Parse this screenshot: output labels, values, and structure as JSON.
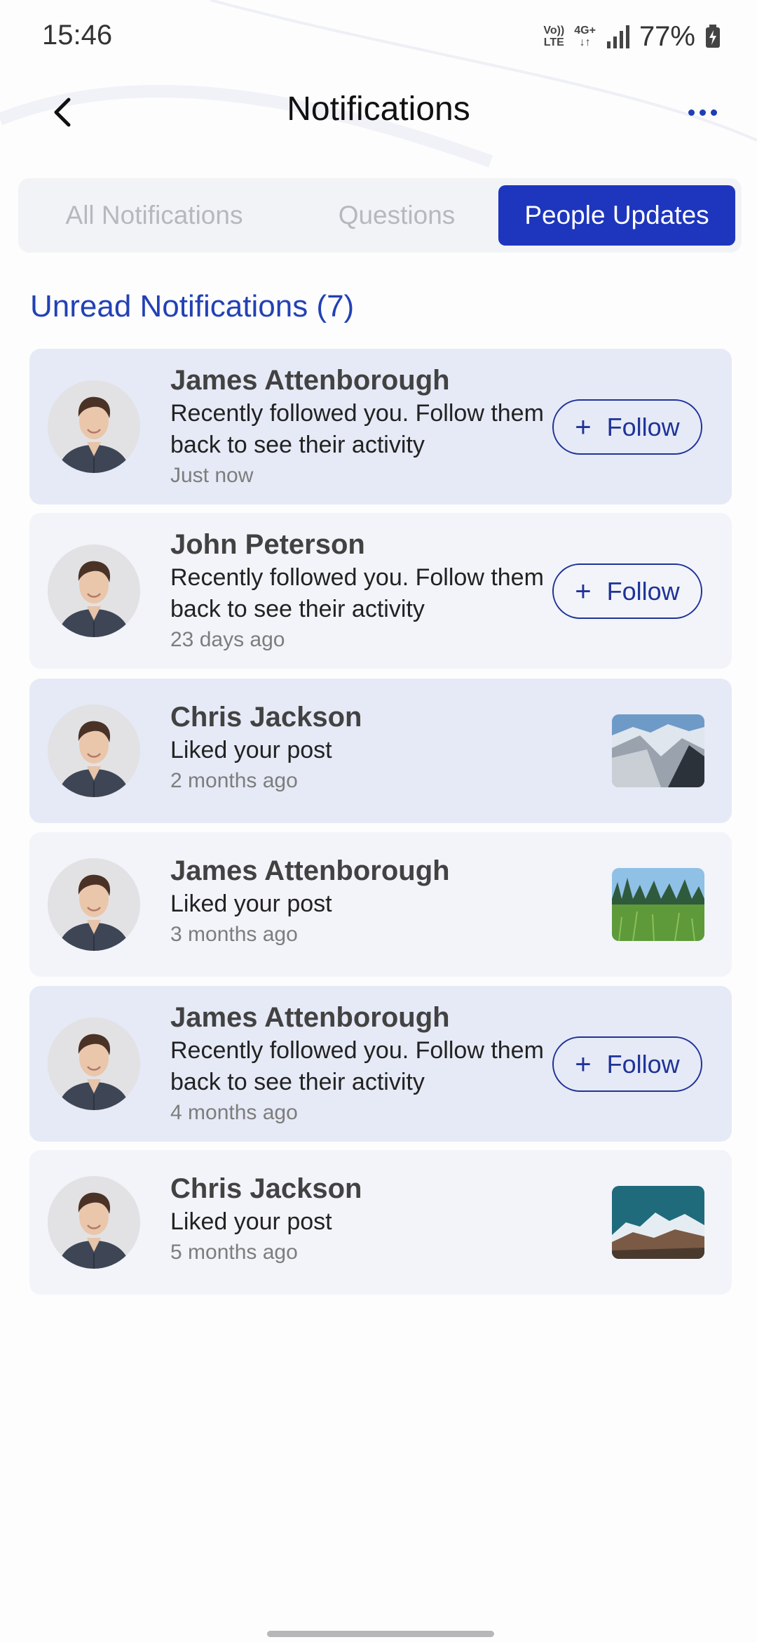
{
  "status_bar": {
    "time": "15:46",
    "volte_top": "Vo))",
    "volte_bottom": "LTE",
    "net_top": "4G+",
    "net_bottom": "↓↑",
    "battery": "77%"
  },
  "header": {
    "title": "Notifications",
    "back_icon": "chevron-left-icon",
    "more_icon": "more-horizontal-icon"
  },
  "tabs": [
    {
      "label": "All Notifications",
      "active": false
    },
    {
      "label": "Questions",
      "active": false
    },
    {
      "label": "People Updates",
      "active": true
    }
  ],
  "section": {
    "title": "Unread Notifications (7)"
  },
  "notifications": [
    {
      "name": "James Attenborough",
      "message": "Recently followed you. Follow them back to see their activity",
      "time": "Just now",
      "action": "follow",
      "action_label": "Follow"
    },
    {
      "name": "John Peterson",
      "message": "Recently followed you. Follow them back to see their activity",
      "time": "23 days ago",
      "action": "follow",
      "action_label": "Follow"
    },
    {
      "name": "Chris Jackson",
      "message": "Liked your post",
      "time": "2 months ago",
      "action": "thumbnail",
      "thumbnail": "snowy-mountain-valley"
    },
    {
      "name": "James Attenborough",
      "message": "Liked your post",
      "time": "3 months ago",
      "action": "thumbnail",
      "thumbnail": "green-meadow-forest"
    },
    {
      "name": "James Attenborough",
      "message": "Recently followed you. Follow them back to see their activity",
      "time": "4 months ago",
      "action": "follow",
      "action_label": "Follow"
    },
    {
      "name": "Chris Jackson",
      "message": "Liked your post",
      "time": "5 months ago",
      "action": "thumbnail",
      "thumbnail": "mountain-lake-teal-sky"
    }
  ],
  "colors": {
    "accent": "#1e36bd",
    "unread_card": "#e6eaf6",
    "read_card": "#f2f4f9",
    "section_title": "#2241b4"
  }
}
